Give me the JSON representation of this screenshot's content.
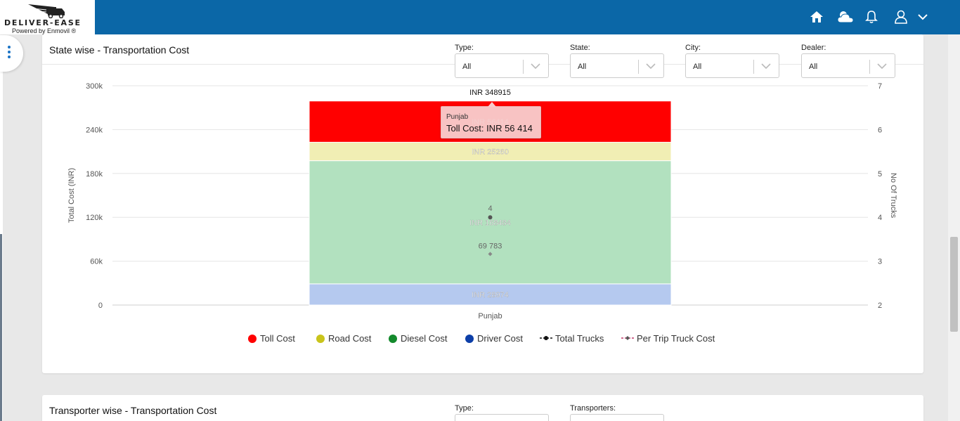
{
  "brand": {
    "name": "DELIVER-EASE",
    "powered_by": "Powered by Enmovil ®"
  },
  "nav_icons": [
    "home-icon",
    "weather-icon",
    "bell-icon",
    "user-icon",
    "chevron-down-icon"
  ],
  "colors": {
    "topbar": "#0b67a7",
    "toll": "#ff0000",
    "road": "#f1eeb4",
    "diesel": "#b2e1bf",
    "driver": "#b5c9ef"
  },
  "state_card": {
    "title": "State wise - Transportation Cost",
    "filters": [
      {
        "label": "Type:",
        "value": "All"
      },
      {
        "label": "State:",
        "value": "All"
      },
      {
        "label": "City:",
        "value": "All"
      },
      {
        "label": "Dealer:",
        "value": "All"
      }
    ]
  },
  "transporter_card": {
    "title": "Transporter wise - Transportation Cost",
    "filters": [
      {
        "label": "Type:"
      },
      {
        "label": "Transporters:"
      }
    ]
  },
  "tooltip": {
    "title": "Punjab",
    "body": "Toll Cost: INR 56 414"
  },
  "legend": [
    "Toll Cost",
    "Road Cost",
    "Diesel Cost",
    "Driver Cost",
    "Total Trucks",
    "Per Trip Truck Cost"
  ],
  "chart_data": {
    "type": "bar",
    "stacked": true,
    "categories": [
      "Punjab"
    ],
    "ylabel": "Total Cost (INR)",
    "y2label": "No Of Trucks",
    "ylim": [
      0,
      300000
    ],
    "y2lim": [
      2,
      7
    ],
    "y_ticks": [
      "0",
      "60k",
      "120k",
      "180k",
      "240k",
      "300k"
    ],
    "y2_ticks": [
      "2",
      "3",
      "4",
      "5",
      "6",
      "7"
    ],
    "total_label": "INR 348915",
    "total": 348915,
    "series": [
      {
        "name": "Driver Cost",
        "values": [
          28974
        ],
        "label": "INR 28974",
        "color": "#b5c9ef"
      },
      {
        "name": "Diesel Cost",
        "values": [
          168484
        ],
        "label": "INR 168484",
        "color": "#b2e1bf"
      },
      {
        "name": "Road Cost",
        "values": [
          25260
        ],
        "label": "INR 25260",
        "color": "#f1eeb4"
      },
      {
        "name": "Toll Cost",
        "values": [
          56414
        ],
        "label": "INR 56414",
        "color": "#ff0000"
      }
    ],
    "line_series": [
      {
        "name": "Total Trucks",
        "values": [
          4
        ],
        "label": "4",
        "axis": "right"
      },
      {
        "name": "Per Trip Truck Cost",
        "values": [
          69783
        ],
        "label": "69 783",
        "axis": "left"
      }
    ],
    "grid": true,
    "legend_position": "bottom"
  }
}
